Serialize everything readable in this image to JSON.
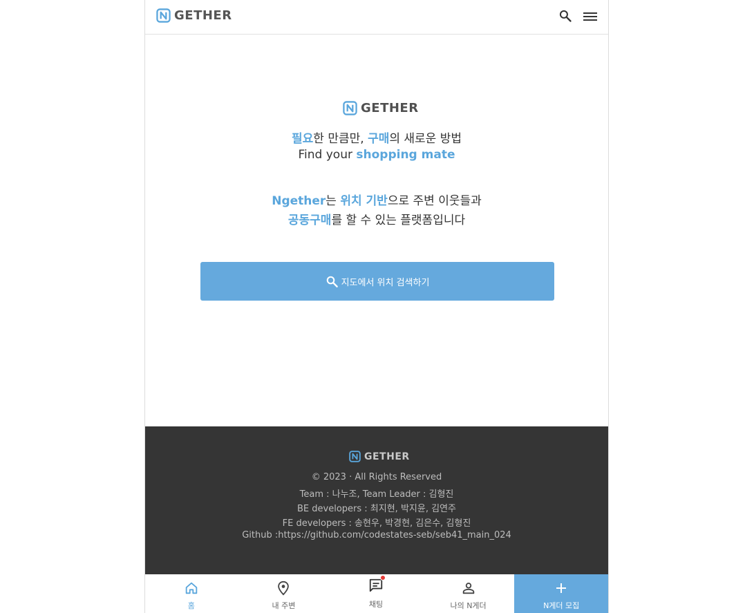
{
  "brand": {
    "word": "GETHER",
    "color": "#5aa6dc"
  },
  "header": {
    "search_icon": "search-icon",
    "menu_icon": "hamburger-menu-icon"
  },
  "hero": {
    "line1": {
      "hl1": "필요",
      "t1": "한 만큼만, ",
      "hl2": "구매",
      "t2": "의 새로운 방법"
    },
    "line2": {
      "t1": "Find your ",
      "hl1": "shopping mate"
    },
    "line3": {
      "hl1": "Ngether",
      "t1": "는 ",
      "hl2": "위치 기반",
      "t2": "으로 주변 이웃들과"
    },
    "line4": {
      "hl1": "공동구매",
      "t1": "를 할 수 있는 플랫폼입니다"
    },
    "cta_label": "지도에서 위치 검색하기",
    "cta_icon": "search-icon"
  },
  "footer": {
    "copyright": "© 2023 · All Rights Reserved",
    "team": "Team : 나누조, Team Leader : 김형진",
    "be": "BE developers : 최지현, 박지윤, 김연주",
    "fe": "FE developers : 송현우, 박경현, 김은수, 김형진",
    "github": "Github :https://github.com/codestates-seb/seb41_main_024",
    "background": "#353535"
  },
  "bottom_nav": {
    "items": [
      {
        "label": "홈",
        "icon": "home-icon",
        "active": true
      },
      {
        "label": "내 주변",
        "icon": "location-pin-icon",
        "active": false
      },
      {
        "label": "채팅",
        "icon": "chat-icon",
        "active": false,
        "badge": true
      },
      {
        "label": "나의 N게더",
        "icon": "person-icon",
        "active": false
      },
      {
        "label": "N게더 모집",
        "icon": "plus-icon",
        "active": false
      }
    ]
  },
  "colors": {
    "accent": "#5aa6dc",
    "button": "#65a9dd",
    "badge": "#e53935"
  }
}
